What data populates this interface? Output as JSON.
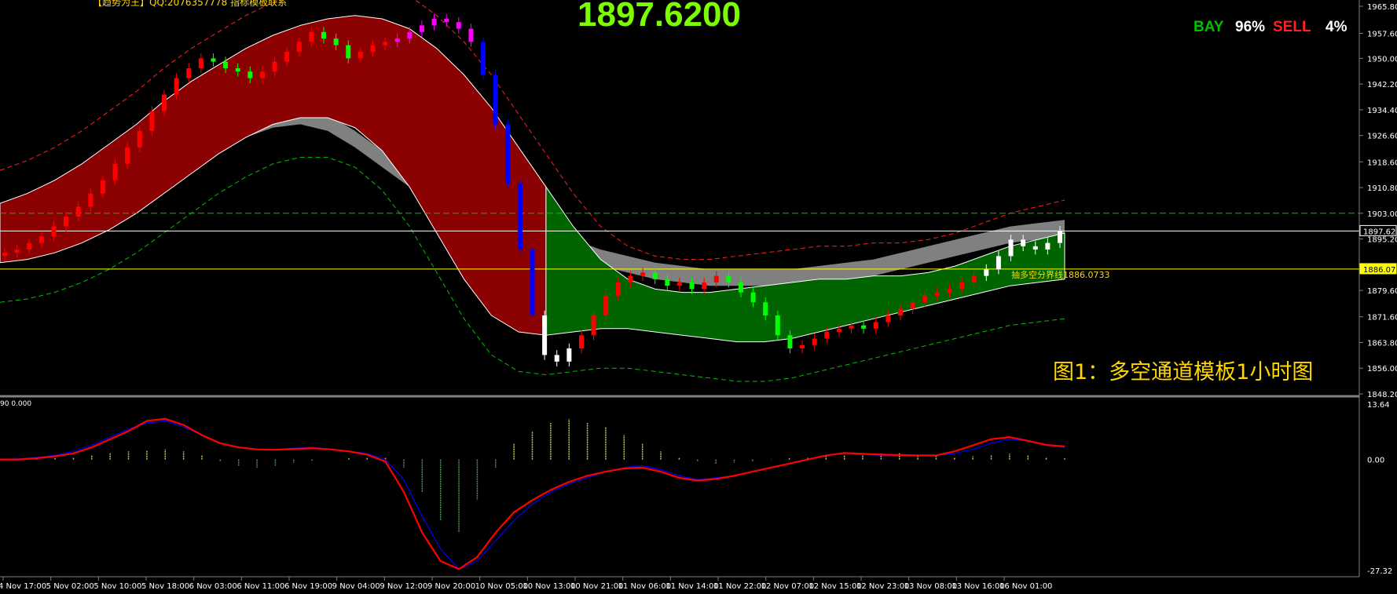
{
  "header": {
    "price_display": "1897.6200",
    "top_note": "【趋势为王】QQ:2076357778 指标模板联系",
    "sentiment": {
      "buy_label": "BAY",
      "buy_value": "96%",
      "sell_label": "SELL",
      "sell_value": "4%",
      "buy_color": "#00c000",
      "sell_color": "#ff2020"
    }
  },
  "caption": "图1：多空通道模板1小时图",
  "annotation": "抽多空分界线1886.0733",
  "sub_indicator_label": "90 0.000",
  "colors": {
    "background": "#000000",
    "bull_channel": "#8b0000",
    "bear_channel": "#006400",
    "neutral_channel": "#808080",
    "current_price_line": "#ffff00",
    "bull_candle": "#ff0000",
    "bear_candle": "#00ff00",
    "trend_up_candle": "#ffffff",
    "trend_down_candle": "#0000ff",
    "magenta_candle": "#ff00ff",
    "macd_fast": "#ff0000",
    "macd_slow": "#0000ff"
  },
  "chart_data": [
    {
      "type": "line",
      "name": "main-price",
      "title": "",
      "xlabel": "",
      "ylabel": "",
      "ylim": [
        1848.2,
        1965.8
      ],
      "yticks": [
        "1965.80",
        "1957.60",
        "1950.00",
        "1942.20",
        "1934.40",
        "1926.60",
        "1918.60",
        "1910.80",
        "1903.00",
        "1895.20",
        "1879.60",
        "1871.60",
        "1863.80",
        "1856.00",
        "1848.20"
      ],
      "ytick_values": [
        1965.8,
        1957.6,
        1950.0,
        1942.2,
        1934.4,
        1926.6,
        1918.6,
        1910.8,
        1903.0,
        1895.2,
        1879.6,
        1871.6,
        1863.8,
        1856.0,
        1848.2
      ],
      "price_labels": [
        {
          "label": "1897.62",
          "value": 1897.62,
          "color": "#ffffff"
        },
        {
          "label": "1886.07",
          "value": 1886.07,
          "color": "#ffff00"
        }
      ],
      "xticks": [
        "4 Nov 17:00",
        "5 Nov 02:00",
        "5 Nov 10:00",
        "5 Nov 18:00",
        "6 Nov 03:00",
        "6 Nov 11:00",
        "6 Nov 19:00",
        "9 Nov 04:00",
        "9 Nov 12:00",
        "9 Nov 20:00",
        "10 Nov 05:00",
        "10 Nov 13:00",
        "10 Nov 21:00",
        "11 Nov 06:00",
        "11 Nov 14:00",
        "11 Nov 22:00",
        "12 Nov 07:00",
        "12 Nov 15:00",
        "12 Nov 23:00",
        "13 Nov 08:00",
        "13 Nov 16:00",
        "16 Nov 01:00"
      ],
      "close": [
        1891,
        1892,
        1894,
        1896,
        1899,
        1902,
        1905,
        1909,
        1913,
        1918,
        1923,
        1928,
        1934,
        1939,
        1944,
        1947,
        1950,
        1949,
        1947,
        1946,
        1944,
        1946,
        1949,
        1952,
        1955,
        1958,
        1956,
        1954,
        1950,
        1952,
        1954,
        1955,
        1956,
        1958,
        1960,
        1962,
        1961,
        1959,
        1955,
        1945,
        1930,
        1912,
        1892,
        1872,
        1860,
        1858,
        1862,
        1866,
        1872,
        1878,
        1882,
        1884,
        1885,
        1883,
        1881,
        1882,
        1880,
        1882,
        1884,
        1882,
        1879,
        1876,
        1872,
        1866,
        1862,
        1863,
        1865,
        1867,
        1868,
        1869,
        1868,
        1870,
        1872,
        1874,
        1876,
        1878,
        1879,
        1880,
        1882,
        1884,
        1886,
        1890,
        1895,
        1893,
        1892,
        1894,
        1897.62
      ],
      "bands": {
        "upper": [
          1906,
          1909,
          1913,
          1918,
          1924,
          1930,
          1937,
          1943,
          1948,
          1953,
          1957,
          1960,
          1962,
          1963,
          1962,
          1959,
          1953,
          1945,
          1935,
          1923,
          1911,
          1899,
          1889,
          1883,
          1880,
          1879,
          1879,
          1880,
          1881,
          1882,
          1883,
          1883,
          1884,
          1884,
          1885,
          1887,
          1890,
          1893,
          1895,
          1897
        ],
        "lower": [
          1888,
          1889,
          1891,
          1894,
          1898,
          1903,
          1909,
          1915,
          1921,
          1926,
          1930,
          1932,
          1932,
          1929,
          1922,
          1911,
          1897,
          1883,
          1872,
          1867,
          1866,
          1867,
          1868,
          1868,
          1867,
          1866,
          1865,
          1864,
          1864,
          1865,
          1867,
          1869,
          1871,
          1873,
          1875,
          1877,
          1879,
          1881,
          1882,
          1883
        ],
        "neutral_upper": [
          1893,
          1894,
          1896,
          1899,
          1903,
          1908,
          1914,
          1920,
          1926,
          1931,
          1934,
          1935,
          1933,
          1928,
          1922,
          1916,
          1911,
          1907,
          1904,
          1901,
          1898,
          1895,
          1892,
          1890,
          1888,
          1887,
          1886,
          1886,
          1886,
          1886,
          1887,
          1888,
          1889,
          1891,
          1893,
          1895,
          1897,
          1899,
          1900,
          1901
        ],
        "neutral_lower": [
          1888,
          1889,
          1891,
          1894,
          1898,
          1903,
          1909,
          1915,
          1921,
          1926,
          1929,
          1930,
          1928,
          1923,
          1917,
          1911,
          1906,
          1902,
          1899,
          1896,
          1893,
          1890,
          1887,
          1885,
          1883,
          1882,
          1881,
          1881,
          1881,
          1881,
          1882,
          1883,
          1884,
          1886,
          1888,
          1890,
          1892,
          1894,
          1895,
          1896
        ]
      }
    },
    {
      "type": "line",
      "name": "macd",
      "ylim": [
        -27.32,
        13.64
      ],
      "yticks": [
        "13.64",
        "0.00",
        "-27.32"
      ],
      "ytick_values": [
        13.64,
        0.0,
        -27.32
      ],
      "series": [
        {
          "name": "",
          "values": [
            0,
            0.2,
            0.5,
            1,
            2,
            3.5,
            5.5,
            7.5,
            9,
            9.5,
            8,
            6,
            4,
            3,
            2.5,
            2.5,
            2.8,
            3,
            2.5,
            2,
            1.5,
            0,
            -5,
            -14,
            -22,
            -27,
            -25,
            -20,
            -15,
            -11,
            -8,
            -6,
            -4.5,
            -3,
            -2,
            -1.5,
            -2.5,
            -4,
            -5,
            -4.5,
            -4,
            -3,
            -2,
            -1,
            0,
            1,
            1.5,
            1.3,
            1,
            1,
            1,
            1,
            1.5,
            2.5,
            4,
            5,
            4.5,
            3.5,
            3
          ]
        },
        {
          "name": "",
          "values": [
            0,
            0,
            0.3,
            0.8,
            1.5,
            3,
            5,
            7,
            9.5,
            10,
            8.5,
            6,
            4,
            3,
            2.5,
            2.4,
            2.6,
            2.8,
            2.5,
            2,
            1.2,
            -0.5,
            -8,
            -18,
            -25,
            -27,
            -24,
            -18,
            -13,
            -10,
            -7.5,
            -5.5,
            -4,
            -3,
            -2.2,
            -2,
            -3,
            -4.5,
            -5.2,
            -4.8,
            -4,
            -3,
            -2,
            -1,
            0,
            1,
            1.6,
            1.4,
            1.2,
            1.1,
            1,
            1,
            2,
            3.5,
            5,
            5.5,
            4.6,
            3.6,
            3.2
          ]
        }
      ],
      "histogram": [
        0,
        0.1,
        0.2,
        0.3,
        0.6,
        1,
        1.5,
        2,
        2.3,
        2.5,
        2,
        1,
        -0.5,
        -1.5,
        -2,
        -1.5,
        -0.8,
        -0.3,
        0,
        0.3,
        0.5,
        0.4,
        -2,
        -8,
        -15,
        -18,
        -10,
        -2,
        4,
        7,
        9,
        10,
        9,
        8,
        6,
        4,
        2,
        0.5,
        -0.5,
        -1,
        -0.8,
        -0.5,
        0,
        0.3,
        0.6,
        0.9,
        1,
        1.2,
        1.5,
        1.6,
        1.2,
        0.8,
        0.5,
        0.8,
        1.2,
        1.4,
        1,
        0.6,
        0.3
      ]
    }
  ]
}
